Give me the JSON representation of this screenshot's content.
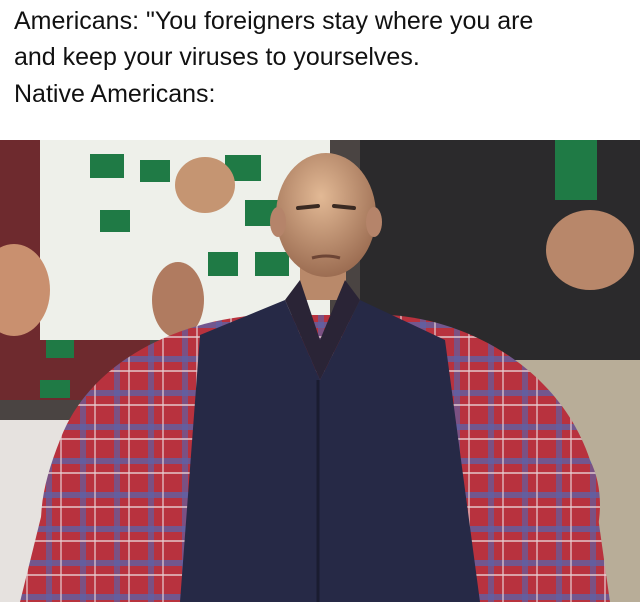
{
  "caption": {
    "line1": "Americans: \"You foreigners stay where you are",
    "line2": "and keep your viruses to yourselves.",
    "line3": "Native Americans:"
  },
  "photo": {
    "subject": "disappointed-cricket-fan",
    "colors": {
      "vest": "#2a2d4a",
      "shirt_red": "#b8323e",
      "shirt_blue": "#4a5a9a",
      "skin": "#c99a78",
      "flag_green": "#1f7a45",
      "crowd_dark": "#3a3432"
    }
  }
}
